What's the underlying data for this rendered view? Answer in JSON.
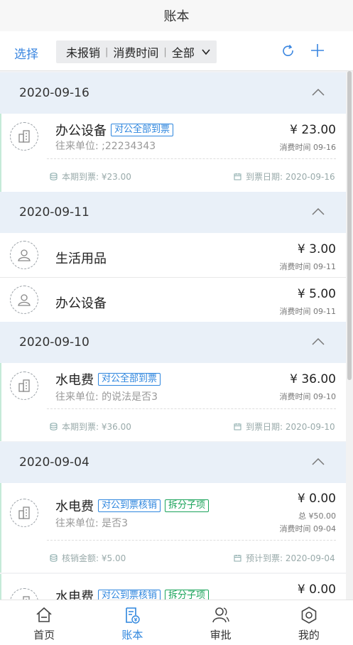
{
  "title": "账本",
  "toolbar": {
    "select_label": "选择",
    "filter_status": "未报销",
    "filter_time": "消费时间",
    "filter_scope": "全部"
  },
  "groups": [
    {
      "date": "2020-09-16",
      "items": [
        {
          "name": "办公设备",
          "tag": "对公全部到票",
          "sub": "往来单位: ;22234343",
          "amount": "¥ 23.00",
          "time": "消费时间 09-16",
          "foot_left": "本期到票: ¥23.00",
          "foot_right": "到票日期: 2020-09-16"
        }
      ]
    },
    {
      "date": "2020-09-11",
      "items": [
        {
          "name": "生活用品",
          "amount": "¥ 3.00",
          "time": "消费时间 09-11"
        },
        {
          "name": "办公设备",
          "amount": "¥ 5.00",
          "time": "消费时间 09-11"
        }
      ]
    },
    {
      "date": "2020-09-10",
      "items": [
        {
          "name": "水电费",
          "tag": "对公全部到票",
          "sub": "往来单位: 的说法是否3",
          "amount": "¥ 36.00",
          "time": "消费时间 09-10",
          "foot_left": "本期到票: ¥36.00",
          "foot_right": "到票日期: 2020-09-10"
        }
      ]
    },
    {
      "date": "2020-09-04",
      "items": [
        {
          "name": "水电费",
          "tag": "对公到票核销",
          "tag2": "拆分子项",
          "sub": "往来单位: 是否3",
          "amount": "¥ 0.00",
          "total": "总 ¥50.00",
          "time": "消费时间 09-04",
          "foot_left": "核销金额: ¥5.00",
          "foot_right": "预计到票: 2020-09-04"
        },
        {
          "name": "水电费",
          "tag": "对公到票核销",
          "tag2": "拆分子项",
          "amount": "¥ 0.00"
        }
      ]
    }
  ],
  "tabs": [
    {
      "label": "首页",
      "icon": "home-icon"
    },
    {
      "label": "账本",
      "icon": "ledger-icon",
      "active": true
    },
    {
      "label": "审批",
      "icon": "approval-icon"
    },
    {
      "label": "我的",
      "icon": "settings-icon"
    }
  ],
  "colors": {
    "accent": "#2e86de",
    "green_tag": "#1aa35a",
    "date_bar": "#e9f0f8"
  }
}
